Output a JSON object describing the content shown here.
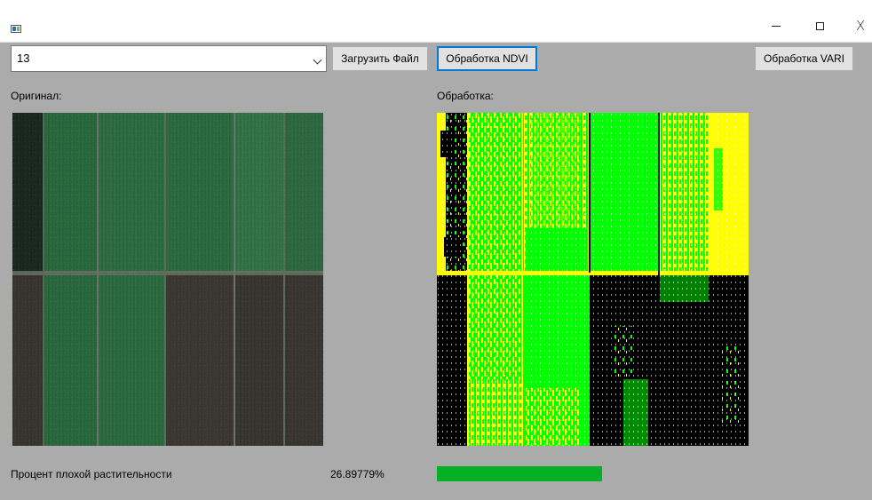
{
  "window": {
    "title": "",
    "controls": {
      "minimize": "−",
      "maximize": "",
      "close": "X"
    }
  },
  "toolbar": {
    "combo_value": "13",
    "load_label": "Загрузить Файл",
    "ndvi_label": "Обработка NDVI",
    "vari_label": "Обработка VARI"
  },
  "labels": {
    "original": "Оригинал:",
    "processed": "Обработка:",
    "bad_vegetation": "Процент плохой растительности",
    "bad_vegetation_value": "26.89779%"
  },
  "progress": {
    "fraction": 0.5314
  },
  "colors": {
    "accent": "#0078d7",
    "progress_fill": "#06b025",
    "ndvi_green": "#00ff00",
    "ndvi_yellow": "#ffff00",
    "ndvi_black": "#000000"
  }
}
